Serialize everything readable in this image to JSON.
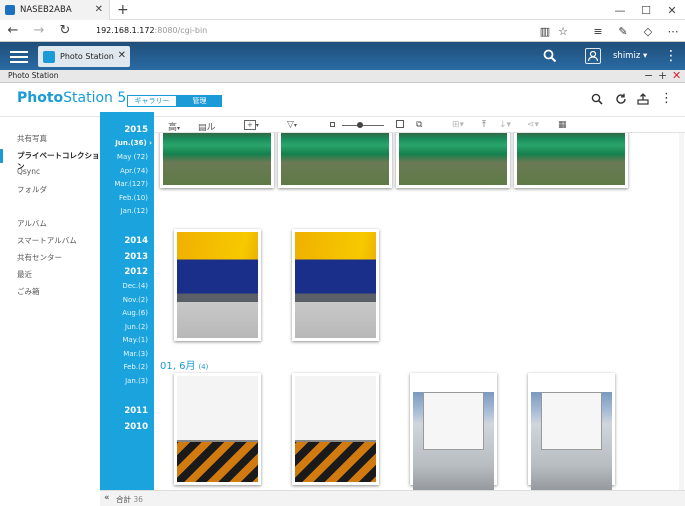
{
  "browser": {
    "tab_title": "NASEB2ABA",
    "url_host": "192.168.1.172",
    "url_rest": ":8080/cgi-bin"
  },
  "nas": {
    "app_tab": "Photo Station",
    "username": "shimiz ▾"
  },
  "window": {
    "title": "Photo Station"
  },
  "app": {
    "logo_main": "Photo",
    "logo_rest": "Station 5",
    "seg_gallery": "ギャラリー",
    "seg_manage": "管理"
  },
  "sidebar": {
    "items": [
      "共有写真",
      "プライベートコレクション",
      "Qsync",
      "フォルダ",
      "アルバム",
      "スマートアルバム",
      "共有センター",
      "最近",
      "ごみ箱"
    ]
  },
  "timeline": {
    "y2015": "2015",
    "m_jun36": "Jun.(36) ›",
    "m_may72": "May (72)",
    "m_apr74": "Apr.(74)",
    "m_mar127": "Mar.(127)",
    "m_feb10": "Feb.(10)",
    "m_jan12": "Jan.(12)",
    "y2014": "2014",
    "y2013": "2013",
    "y2012": "2012",
    "m_dec4": "Dec.(4)",
    "m_nov2": "Nov.(2)",
    "m_aug6": "Aug.(6)",
    "m_jun2": "Jun.(2)",
    "m_may1": "May.(1)",
    "m_mar3": "Mar.(3)",
    "m_feb2": "Feb.(2)",
    "m_jan3": "Jan.(3)",
    "y2011": "2011",
    "y2010": "2010"
  },
  "toolbar": {
    "sort_label": "高",
    "view_label": "ル",
    "add_label": "+"
  },
  "content": {
    "date_header": "01, 6月",
    "date_count": "(4)"
  },
  "footer": {
    "chevron": "«",
    "total_label": "合計",
    "total_value": "36"
  },
  "colors": {
    "accent": "#1a9ad6",
    "timeline": "#1aa3dc",
    "nasbar": "#1f4e79"
  }
}
